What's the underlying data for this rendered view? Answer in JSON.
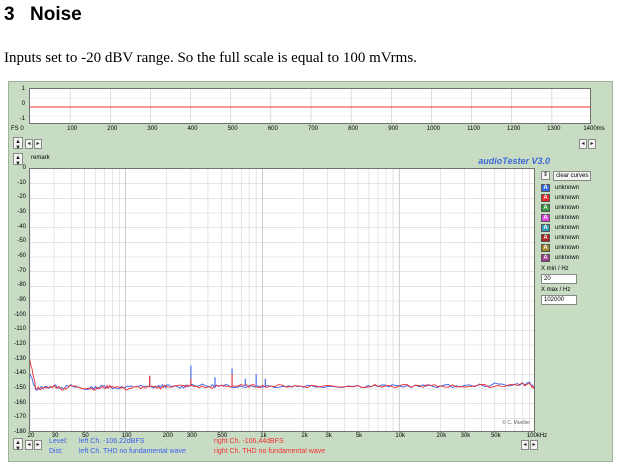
{
  "doc": {
    "section_number": "3",
    "section_title": "Noise",
    "paragraph": "Inputs set to -20 dBV range. So the full scale is equal to 100 mVrms."
  },
  "app": {
    "title": "audioTester V3.0",
    "remark_label": "remark",
    "fs_label": "FS 0",
    "watermark": "© C. Mueller",
    "colors": {
      "background": "#c8dcc4",
      "left": "#3a5fe8",
      "right": "#f03030",
      "title": "#3b6ad8"
    }
  },
  "top_plot": {
    "y_ticks": [
      "1",
      "0",
      "-1"
    ],
    "x_ticks": [
      "100",
      "200",
      "300",
      "400",
      "500",
      "600",
      "700",
      "800",
      "900",
      "1000",
      "1100",
      "1200",
      "1300",
      "1400ms"
    ]
  },
  "main_plot": {
    "y_ticks": [
      "0",
      "-10",
      "-20",
      "-30",
      "-40",
      "-50",
      "-60",
      "-70",
      "-80",
      "-90",
      "-100",
      "-110",
      "-120",
      "-130",
      "-140",
      "-150",
      "-160",
      "-170",
      "-180"
    ],
    "x_ticks": [
      "20",
      "30",
      "50",
      "100",
      "200",
      "300",
      "500",
      "1k",
      "2k",
      "3k",
      "5k",
      "10k",
      "20k",
      "30k",
      "50k",
      "100kHz"
    ],
    "top_marker": "dBFS"
  },
  "side_panel": {
    "clear_label": "clear curves",
    "curves": [
      {
        "letter": "A",
        "label": "unknown",
        "color": "#2f6ae8"
      },
      {
        "letter": "A",
        "label": "unknown",
        "color": "#ee2222"
      },
      {
        "letter": "A",
        "label": "unknown",
        "color": "#2e9a3c"
      },
      {
        "letter": "A",
        "label": "unknown",
        "color": "#e040e0"
      },
      {
        "letter": "A",
        "label": "unknown",
        "color": "#2fa0b8"
      },
      {
        "letter": "A",
        "label": "unknown",
        "color": "#b02020"
      },
      {
        "letter": "A",
        "label": "unknown",
        "color": "#a08a2a"
      },
      {
        "letter": "A",
        "label": "unknown",
        "color": "#a03a8a"
      }
    ],
    "xmin_label": "X min / Hz",
    "xmin_value": "20",
    "xmax_label": "X max / Hz",
    "xmax_value": "102000"
  },
  "status": {
    "level_label": "Level:",
    "level_left": "left Ch. -106,22dBFS",
    "level_right": "right Ch. -106,44dBFS",
    "dist_label": "Dist:",
    "dist_left": "left Ch. THD no fundamental wave",
    "dist_right": "right Ch. THD no fundamental wave"
  },
  "chart_data": {
    "type": "line",
    "x_scale": "log",
    "xlim": [
      20,
      100000
    ],
    "ylim": [
      -180,
      0
    ],
    "grid": true,
    "series": [
      {
        "name": "left Ch.",
        "color": "#3a5fe8",
        "x": [
          20,
          22,
          25,
          30,
          35,
          40,
          50,
          60,
          70,
          80,
          100,
          120,
          150,
          180,
          200,
          250,
          300,
          400,
          500,
          600,
          800,
          1000,
          1500,
          2000,
          3000,
          5000,
          7000,
          10000,
          15000,
          20000,
          30000,
          50000,
          70000,
          90000,
          100000
        ],
        "y": [
          -140,
          -150,
          -149,
          -148,
          -149,
          -148,
          -150,
          -149,
          -148,
          -149,
          -149,
          -148,
          -149,
          -148,
          -148,
          -149,
          -147,
          -148,
          -148,
          -148,
          -148,
          -148,
          -148,
          -148,
          -148,
          -148,
          -148,
          -148,
          -148,
          -148,
          -148,
          -147,
          -147,
          -146,
          -150
        ]
      },
      {
        "name": "right Ch.",
        "color": "#f03030",
        "x": [
          20,
          22,
          25,
          30,
          35,
          40,
          50,
          60,
          70,
          80,
          100,
          120,
          150,
          180,
          200,
          250,
          300,
          400,
          500,
          600,
          800,
          1000,
          1500,
          2000,
          3000,
          5000,
          7000,
          10000,
          15000,
          20000,
          30000,
          50000,
          70000,
          90000,
          100000
        ],
        "y": [
          -130,
          -149,
          -150,
          -148,
          -150,
          -148,
          -149,
          -150,
          -149,
          -148,
          -150,
          -149,
          -149,
          -149,
          -148,
          -148,
          -148,
          -149,
          -148,
          -148,
          -148,
          -148,
          -148,
          -148,
          -148,
          -148,
          -148,
          -148,
          -148,
          -148,
          -148,
          -148,
          -147,
          -147,
          -150
        ]
      }
    ],
    "spikes": [
      {
        "series": "left Ch.",
        "x": 150,
        "y": -141
      },
      {
        "series": "right Ch.",
        "x": 150,
        "y": -141
      },
      {
        "series": "left Ch.",
        "x": 300,
        "y": -134
      },
      {
        "series": "right Ch.",
        "x": 300,
        "y": -143
      },
      {
        "series": "left Ch.",
        "x": 450,
        "y": -142
      },
      {
        "series": "left Ch.",
        "x": 600,
        "y": -136
      },
      {
        "series": "right Ch.",
        "x": 600,
        "y": -140
      },
      {
        "series": "left Ch.",
        "x": 750,
        "y": -143
      },
      {
        "series": "left Ch.",
        "x": 900,
        "y": -140
      },
      {
        "series": "left Ch.",
        "x": 1050,
        "y": -143
      }
    ],
    "top_plot": {
      "type": "line",
      "xlim": [
        0,
        1400
      ],
      "ylim": [
        -1,
        1
      ],
      "series": [
        {
          "name": "left Ch.",
          "color": "#3a5fe8",
          "x": [
            0,
            1400
          ],
          "y": [
            0,
            0
          ]
        },
        {
          "name": "right Ch.",
          "color": "#f03030",
          "x": [
            0,
            1400
          ],
          "y": [
            0,
            0
          ]
        }
      ]
    }
  }
}
